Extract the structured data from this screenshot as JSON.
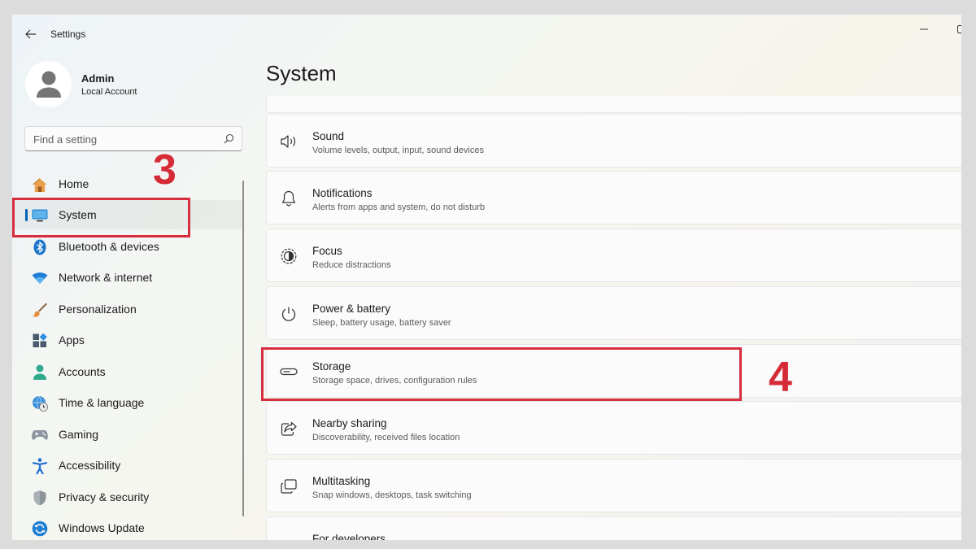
{
  "window": {
    "title": "Settings"
  },
  "profile": {
    "name": "Admin",
    "account_type": "Local Account"
  },
  "search": {
    "placeholder": "Find a setting"
  },
  "nav": {
    "items": [
      {
        "label": "Home",
        "icon": "home-icon"
      },
      {
        "label": "System",
        "icon": "display-icon",
        "selected": true
      },
      {
        "label": "Bluetooth & devices",
        "icon": "bluetooth-icon"
      },
      {
        "label": "Network & internet",
        "icon": "wifi-icon"
      },
      {
        "label": "Personalization",
        "icon": "brush-icon"
      },
      {
        "label": "Apps",
        "icon": "apps-icon"
      },
      {
        "label": "Accounts",
        "icon": "accounts-icon"
      },
      {
        "label": "Time & language",
        "icon": "clock-globe-icon"
      },
      {
        "label": "Gaming",
        "icon": "gamepad-icon"
      },
      {
        "label": "Accessibility",
        "icon": "accessibility-icon"
      },
      {
        "label": "Privacy & security",
        "icon": "shield-icon"
      },
      {
        "label": "Windows Update",
        "icon": "update-icon"
      }
    ]
  },
  "main": {
    "title": "System",
    "cards": [
      {
        "title": "Sound",
        "subtitle": "Volume levels, output, input, sound devices",
        "icon": "speaker-icon"
      },
      {
        "title": "Notifications",
        "subtitle": "Alerts from apps and system, do not disturb",
        "icon": "bell-icon"
      },
      {
        "title": "Focus",
        "subtitle": "Reduce distractions",
        "icon": "focus-icon"
      },
      {
        "title": "Power & battery",
        "subtitle": "Sleep, battery usage, battery saver",
        "icon": "power-icon"
      },
      {
        "title": "Storage",
        "subtitle": "Storage space, drives, configuration rules",
        "icon": "drive-icon"
      },
      {
        "title": "Nearby sharing",
        "subtitle": "Discoverability, received files location",
        "icon": "share-icon"
      },
      {
        "title": "Multitasking",
        "subtitle": "Snap windows, desktops, task switching",
        "icon": "multitask-icon"
      },
      {
        "title": "For developers",
        "subtitle": "",
        "icon": "developer-icon"
      }
    ]
  },
  "annotations": {
    "step_a": "3",
    "step_b": "4",
    "color": "#d62e3e"
  },
  "colors": {
    "accent": "#005fb8"
  }
}
